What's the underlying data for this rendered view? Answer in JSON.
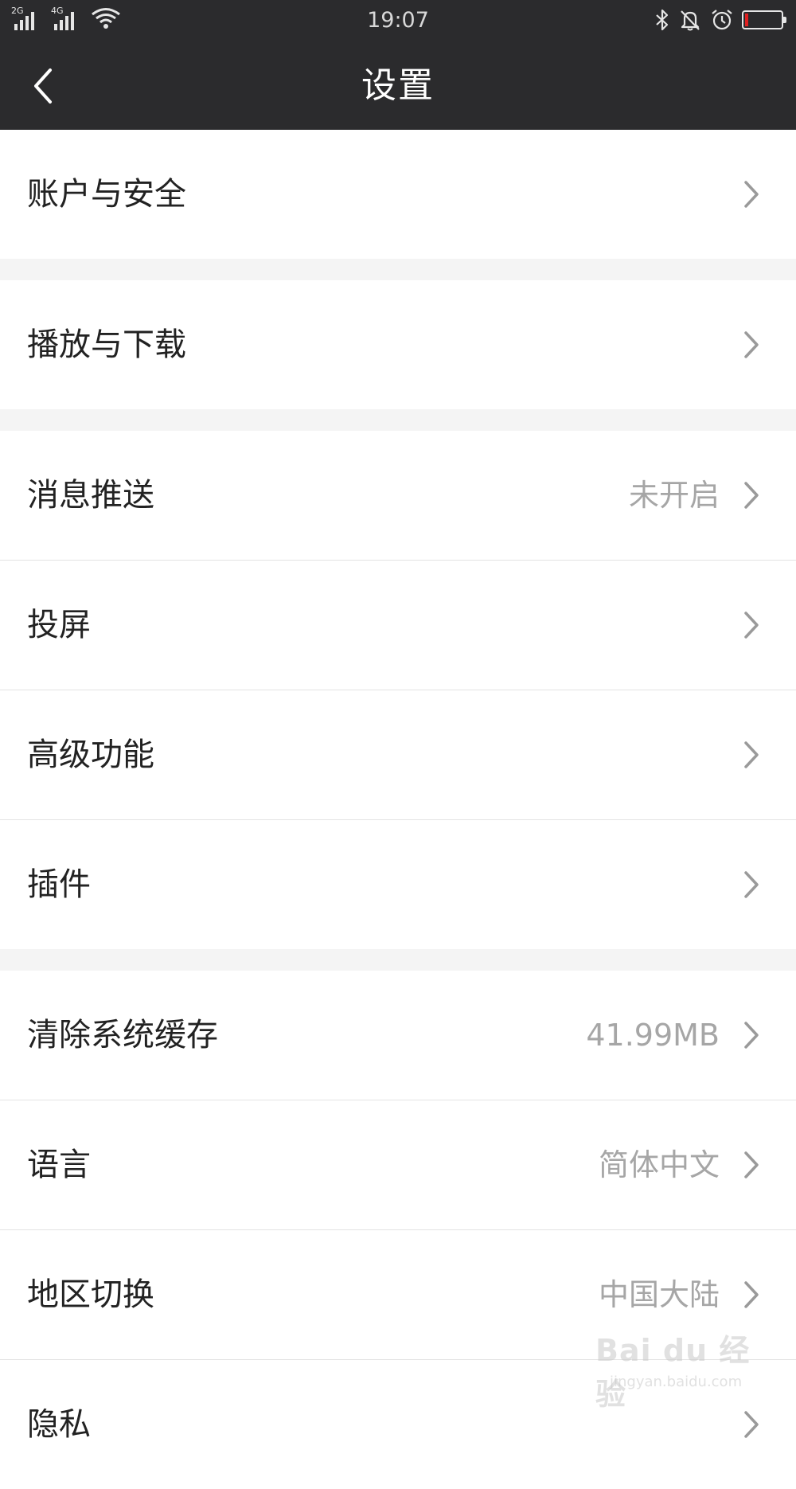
{
  "status_bar": {
    "sim1_network": "2G",
    "sim2_network": "4G",
    "time": "19:07",
    "battery_level": 0.08,
    "icons": [
      "wifi-icon",
      "bluetooth-icon",
      "bell-muted-icon",
      "alarm-icon",
      "battery-icon"
    ]
  },
  "header": {
    "title": "设置",
    "back_icon": "chevron-left-icon",
    "background": "#2b2b2d"
  },
  "rows": [
    {
      "label": "账户与安全",
      "value": ""
    },
    {
      "label": "播放与下载",
      "value": ""
    },
    {
      "label": "消息推送",
      "value": "未开启"
    },
    {
      "label": "投屏",
      "value": ""
    },
    {
      "label": "高级功能",
      "value": ""
    },
    {
      "label": "插件",
      "value": ""
    },
    {
      "label": "清除系统缓存",
      "value": "41.99MB"
    },
    {
      "label": "语言",
      "value": "简体中文"
    },
    {
      "label": "地区切换",
      "value": "中国大陆"
    },
    {
      "label": "隐私",
      "value": ""
    }
  ],
  "watermark": {
    "main": "Bai du 经验",
    "sub": "jingyan.baidu.com"
  },
  "colors": {
    "label": "#222222",
    "value": "#a6a6a6",
    "chevron": "#9a9a9a",
    "section_gap": "#f4f4f4",
    "battery_low": "#e02020"
  }
}
